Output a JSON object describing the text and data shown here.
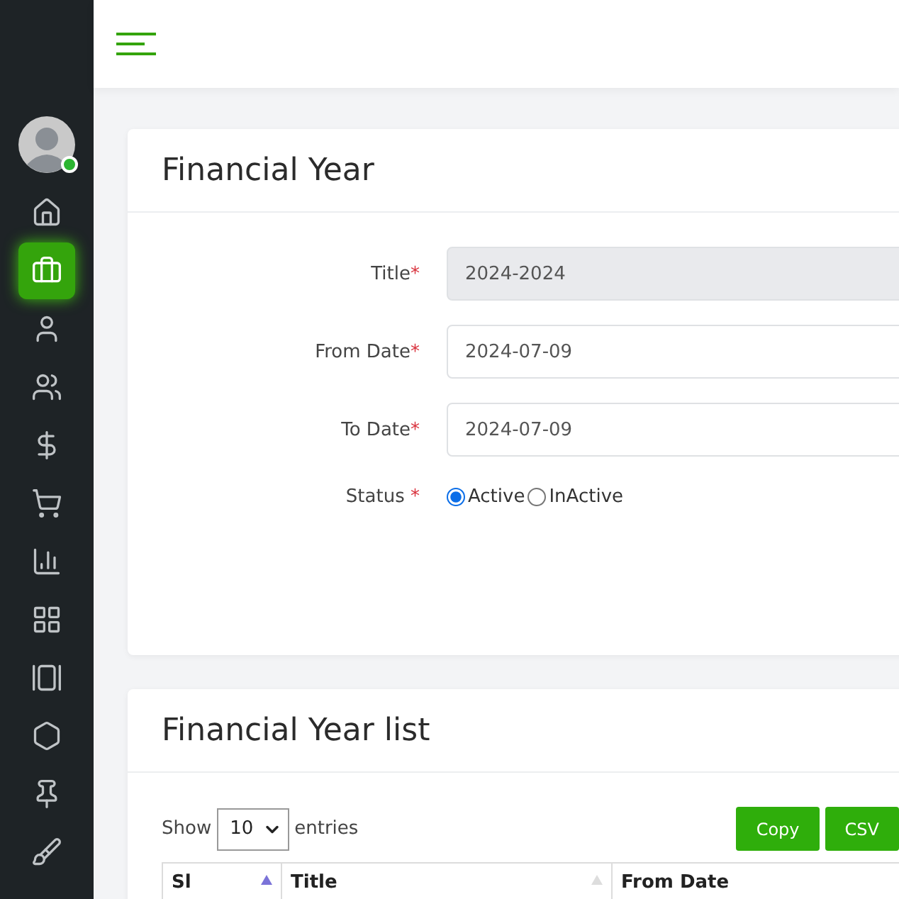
{
  "sidebar": {
    "items": [
      {
        "kind": "home",
        "selected": false
      },
      {
        "kind": "bag",
        "selected": true
      },
      {
        "kind": "user",
        "selected": false
      },
      {
        "kind": "users",
        "selected": false
      },
      {
        "kind": "dollar",
        "selected": false
      },
      {
        "kind": "cart",
        "selected": false
      },
      {
        "kind": "chart",
        "selected": false
      },
      {
        "kind": "grid",
        "selected": false
      },
      {
        "kind": "slides",
        "selected": false
      },
      {
        "kind": "hexagon",
        "selected": false
      },
      {
        "kind": "pin",
        "selected": false
      },
      {
        "kind": "brush",
        "selected": false
      }
    ]
  },
  "form": {
    "title": "Financial Year",
    "fields": [
      {
        "label": "Title",
        "required": "*",
        "value": "2024-2024",
        "disabled": true
      },
      {
        "label": "From Date",
        "required": "*",
        "value": "2024-07-09",
        "disabled": false
      },
      {
        "label": "To Date",
        "required": "*",
        "value": "2024-07-09",
        "disabled": false
      }
    ],
    "status": {
      "label": "Status",
      "required": "*",
      "options": [
        {
          "label": "Active",
          "selected": true
        },
        {
          "label": "InActive",
          "selected": false
        }
      ]
    }
  },
  "list": {
    "title": "Financial Year list",
    "show_label": "Show",
    "page_size": "10",
    "entries_label": "entries",
    "buttons": [
      "Copy",
      "CSV"
    ],
    "columns": [
      {
        "label": "Sl",
        "sorted": true
      },
      {
        "label": "Title",
        "sorted": false
      },
      {
        "label": "From Date"
      }
    ]
  }
}
